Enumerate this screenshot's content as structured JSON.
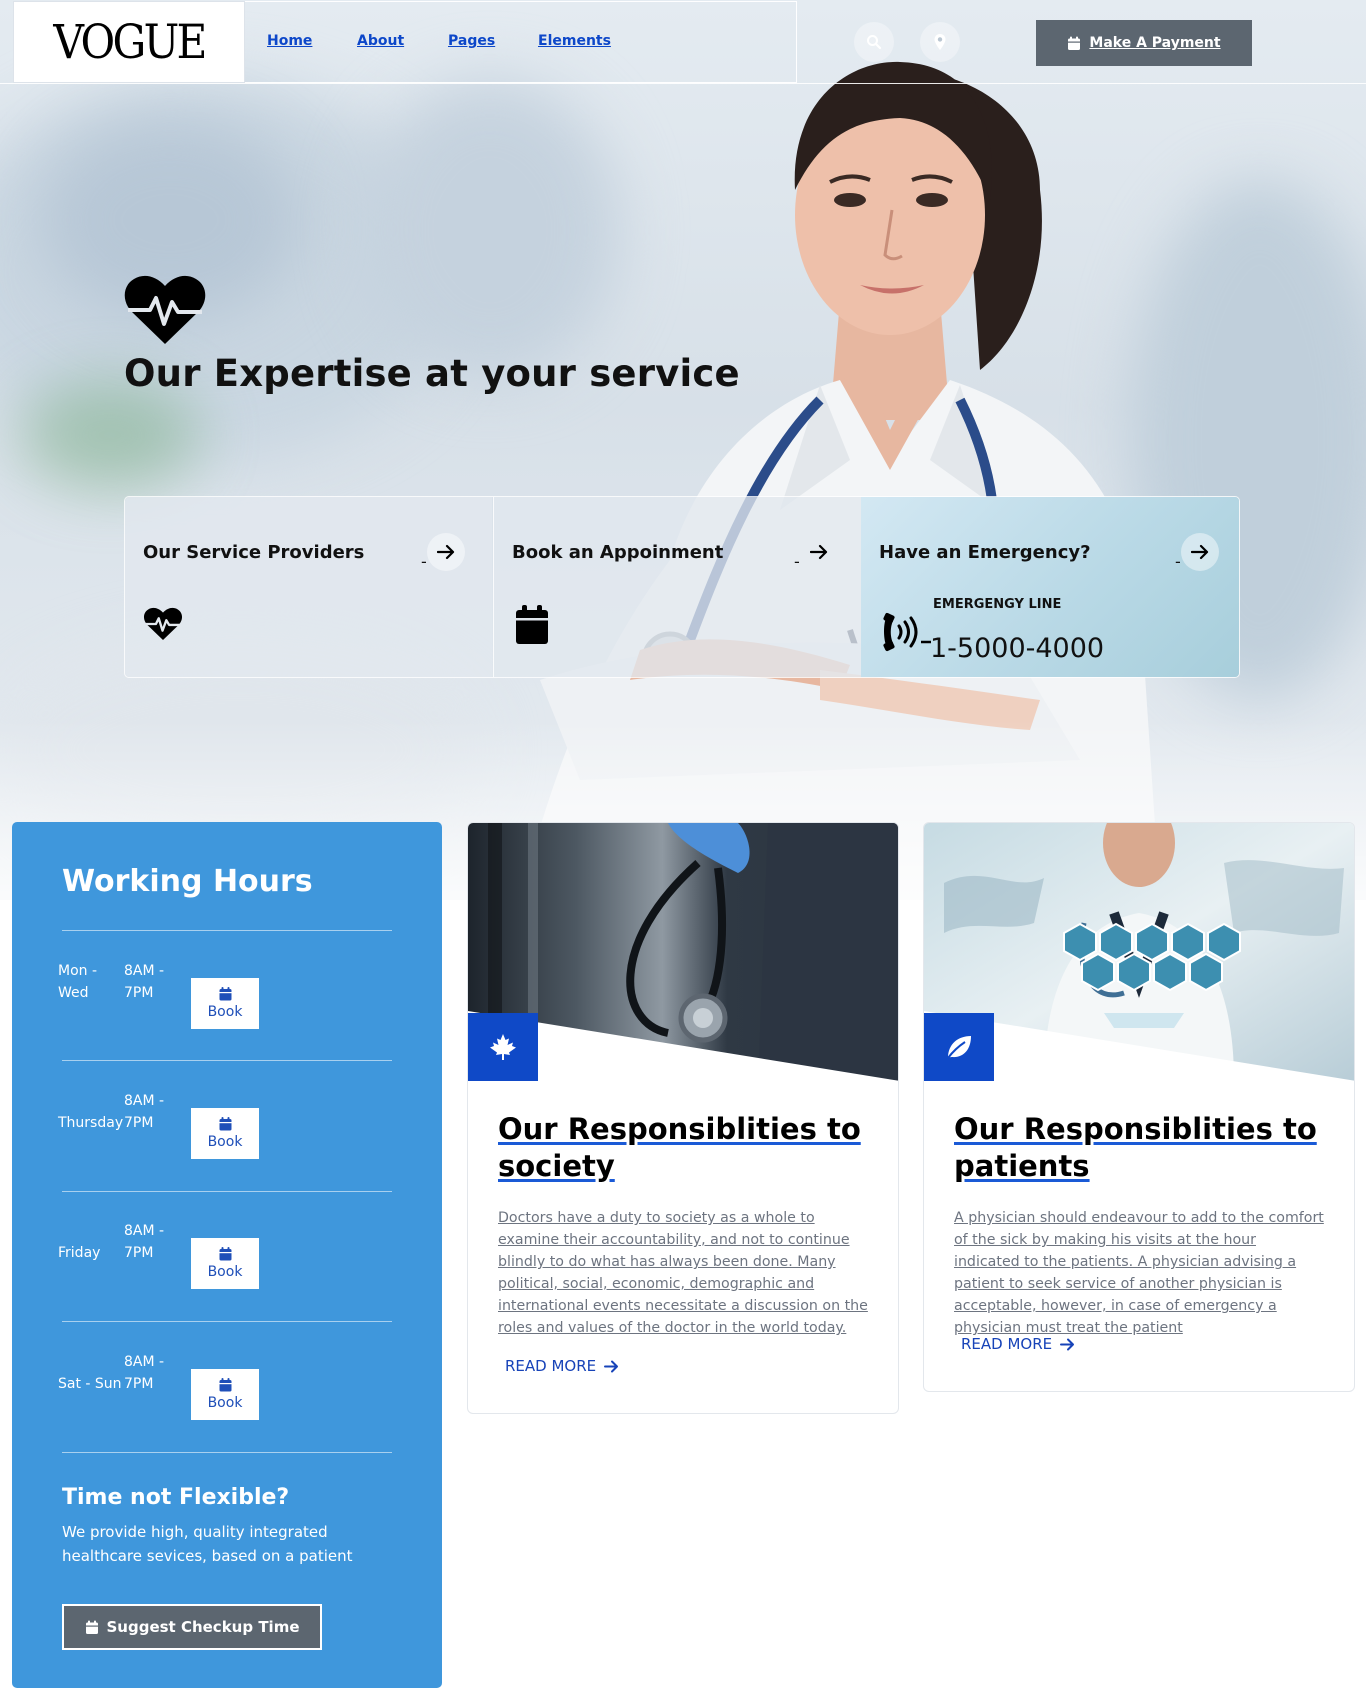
{
  "nav": {
    "logo": "VOGUE",
    "links": [
      "Home",
      "About",
      "Pages",
      "Elements"
    ],
    "search_icon": "search-icon",
    "location_icon": "map-pin-icon",
    "payment_button": "Make A Payment"
  },
  "hero": {
    "title": "Our Expertise at your service",
    "icon": "heartbeat-icon"
  },
  "services": [
    {
      "title": "Our Service Providers",
      "icon": "heartbeat-icon"
    },
    {
      "title": "Book an Appoinment",
      "icon": "calendar-icon"
    },
    {
      "title": "Have an Emergency?",
      "line_label": "EMERGENGY LINE",
      "number": "1-5000-4000",
      "icon": "phone-volume-icon"
    }
  ],
  "hours": {
    "title": "Working Hours",
    "rows": [
      {
        "day": "Mon - Wed",
        "time": "8AM - 7PM",
        "button": "Book"
      },
      {
        "day": "Thursday",
        "time": "8AM - 7PM",
        "button": "Book"
      },
      {
        "day": "Friday",
        "time": "8AM - 7PM",
        "button": "Book"
      },
      {
        "day": "Sat - Sun",
        "time": "8AM - 7PM",
        "button": "Book"
      }
    ],
    "flex_title": "Time not Flexible?",
    "flex_text": "We provide high, quality integrated healthcare sevices, based on a patient",
    "suggest_button": "Suggest Checkup Time"
  },
  "responsibilities": [
    {
      "title": "Our Responsiblities to society",
      "text": "Doctors have a duty to society as a whole to examine their accountability, and not to continue blindly to do what has always been done. Many political, social, economic, demographic and international events necessitate a discussion on the roles and values of the doctor in the world today.",
      "link": "READ MORE",
      "icon": "maple-leaf-icon"
    },
    {
      "title": "Our Responsiblities to patients",
      "text": "A physician should endeavour to add to the comfort of the sick by making his visits at the hour indicated to the patients. A physician advising a patient to seek service of another physician is acceptable, however, in case of emergency a physician must treat the patient",
      "link": "READ MORE",
      "icon": "leaf-icon"
    }
  ],
  "colors": {
    "accent_blue": "#0f49c7",
    "panel_blue": "#3f97dc",
    "button_gray": "#5c6670"
  }
}
